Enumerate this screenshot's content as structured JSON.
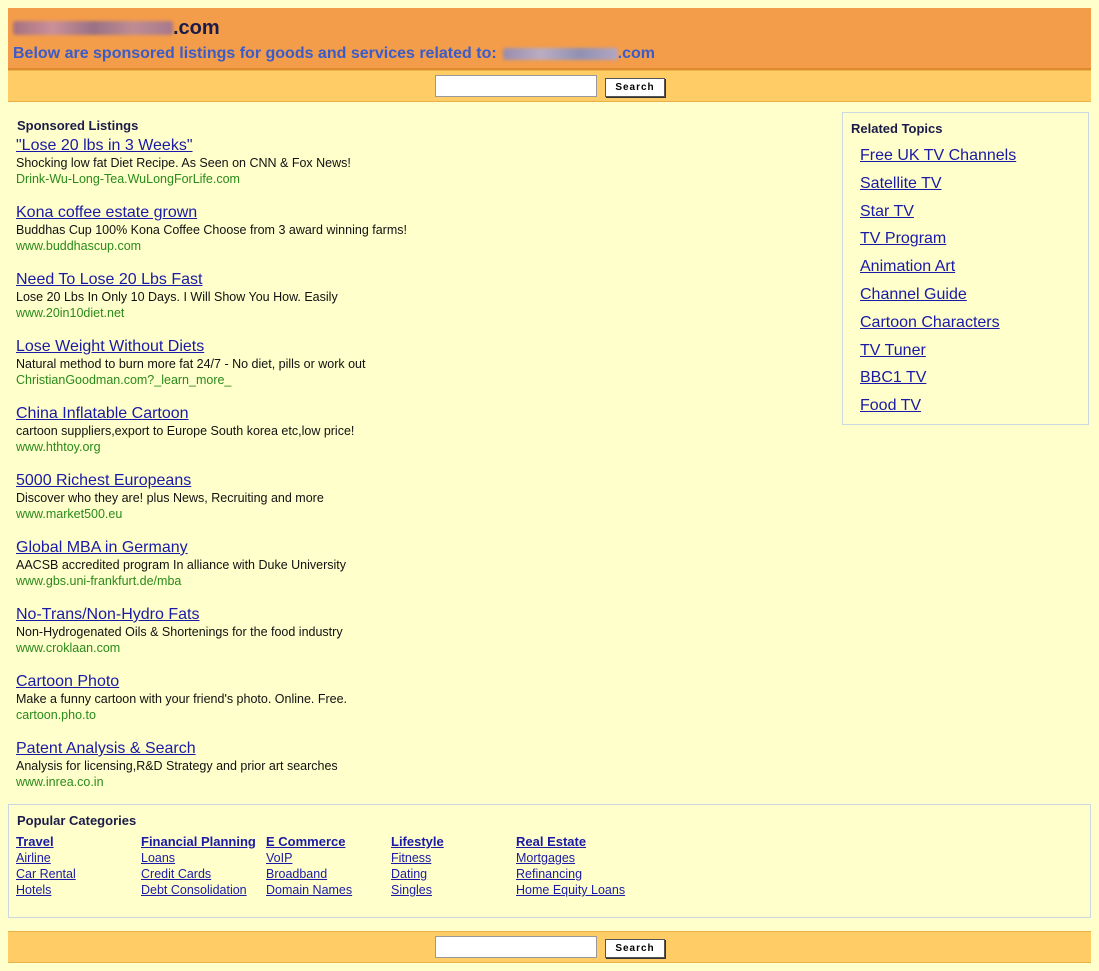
{
  "header": {
    "domain_tld": ".com",
    "sponsored_intro": "Below are sponsored listings for goods and services related to:",
    "related_domain_tld": ".com"
  },
  "search": {
    "button_label": "Search",
    "placeholder": ""
  },
  "sponsored": {
    "title": "Sponsored Listings",
    "ads": [
      {
        "title": "\"Lose 20 lbs in 3 Weeks\"",
        "desc": "Shocking low fat Diet Recipe. As Seen on CNN & Fox News!",
        "url": "Drink-Wu-Long-Tea.WuLongForLife.com"
      },
      {
        "title": "Kona coffee estate grown",
        "desc": "Buddhas Cup 100% Kona Coffee Choose from 3 award winning farms!",
        "url": "www.buddhascup.com"
      },
      {
        "title": "Need To Lose 20 Lbs Fast",
        "desc": "Lose 20 Lbs In Only 10 Days. I Will Show You How. Easily",
        "url": "www.20in10diet.net"
      },
      {
        "title": "Lose Weight Without Diets",
        "desc": "Natural method to burn more fat 24/7 - No diet, pills or work out",
        "url": "ChristianGoodman.com?_learn_more_"
      },
      {
        "title": "China Inflatable Cartoon",
        "desc": "cartoon suppliers,export to Europe South korea etc,low price!",
        "url": "www.hthtoy.org"
      },
      {
        "title": "5000 Richest Europeans",
        "desc": "Discover who they are! plus News, Recruiting and more",
        "url": "www.market500.eu"
      },
      {
        "title": "Global MBA in Germany",
        "desc": "AACSB accredited program In alliance with Duke University",
        "url": "www.gbs.uni-frankfurt.de/mba"
      },
      {
        "title": "No-Trans/Non-Hydro Fats",
        "desc": "Non-Hydrogenated Oils & Shortenings for the food industry",
        "url": "www.croklaan.com"
      },
      {
        "title": "Cartoon Photo",
        "desc": "Make a funny cartoon with your friend's photo. Online. Free.",
        "url": "cartoon.pho.to"
      },
      {
        "title": "Patent Analysis & Search",
        "desc": "Analysis for licensing,R&D Strategy and prior art searches",
        "url": "www.inrea.co.in"
      }
    ]
  },
  "related": {
    "title": "Related Topics",
    "items": [
      "Free UK TV Channels",
      "Satellite TV",
      "Star TV",
      "TV Program",
      "Animation Art",
      "Channel Guide",
      "Cartoon Characters",
      "TV Tuner",
      "BBC1 TV",
      "Food TV"
    ]
  },
  "popular": {
    "title": "Popular Categories",
    "categories": [
      {
        "head": "Travel",
        "items": [
          "Airline",
          "Car Rental",
          "Hotels"
        ]
      },
      {
        "head": "Financial Planning",
        "items": [
          "Loans",
          "Credit Cards",
          "Debt Consolidation"
        ]
      },
      {
        "head": "E Commerce",
        "items": [
          "VoIP",
          "Broadband",
          "Domain Names"
        ]
      },
      {
        "head": "Lifestyle",
        "items": [
          "Fitness",
          "Dating",
          "Singles"
        ]
      },
      {
        "head": "Real Estate",
        "items": [
          "Mortgages",
          "Refinancing",
          "Home Equity Loans"
        ]
      }
    ]
  },
  "colors": {
    "header_bg": "#f39c4a",
    "searchbar_bg": "#ffcc66",
    "page_bg": "#ffffcc",
    "link": "#1a1aa6",
    "ad_url": "#2a8a1a",
    "intro_text": "#3b5cc8"
  }
}
